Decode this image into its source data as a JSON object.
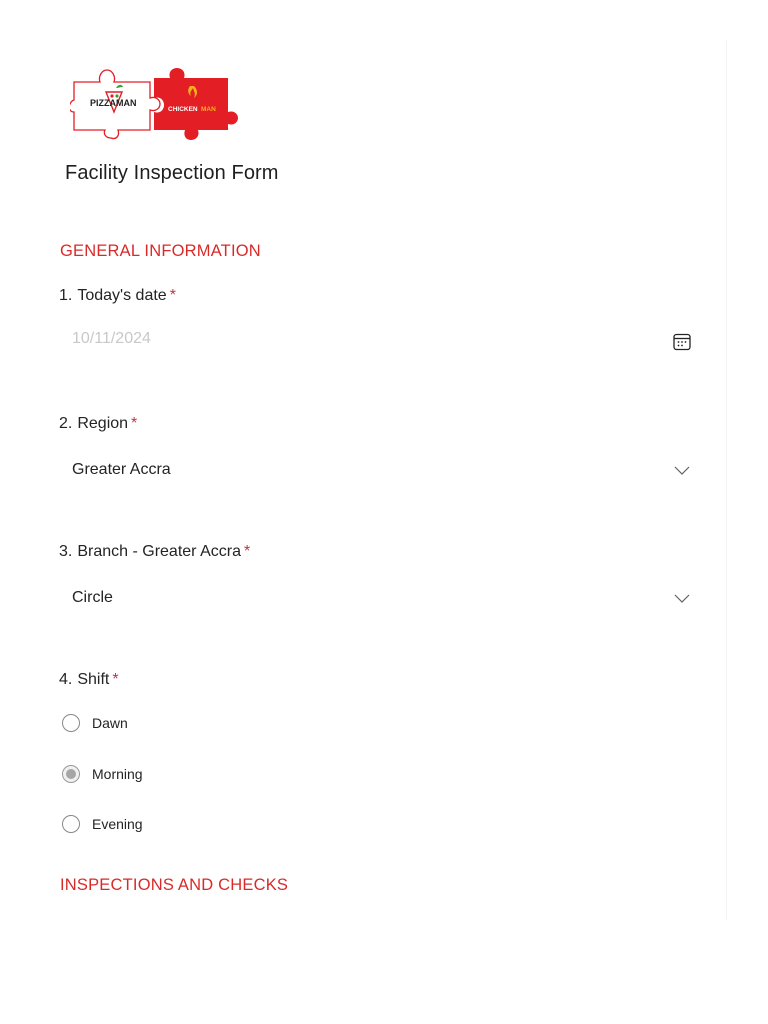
{
  "logo": {
    "left_text": "PIZZAMAN",
    "right_text_1": "CHICKEN",
    "right_text_2": "MAN",
    "accent_color": "#e31e24"
  },
  "form": {
    "title": "Facility Inspection Form"
  },
  "sections": {
    "general": "GENERAL INFORMATION",
    "inspections": "INSPECTIONS AND CHECKS"
  },
  "questions": [
    {
      "number": "1.",
      "label": "Today's date",
      "required_mark": "*",
      "placeholder": "10/11/2024",
      "icon": "calendar-icon"
    },
    {
      "number": "2.",
      "label": "Region",
      "required_mark": "*",
      "value": "Greater Accra",
      "icon": "chevron-down-icon"
    },
    {
      "number": "3.",
      "label": "Branch - Greater Accra",
      "required_mark": "*",
      "value": "Circle",
      "icon": "chevron-down-icon"
    },
    {
      "number": "4.",
      "label": "Shift",
      "required_mark": "*",
      "options": [
        "Dawn",
        "Morning",
        "Evening"
      ],
      "selected": "Morning"
    }
  ],
  "colors": {
    "section_title": "#d92a2a",
    "required": "#c4314b"
  }
}
